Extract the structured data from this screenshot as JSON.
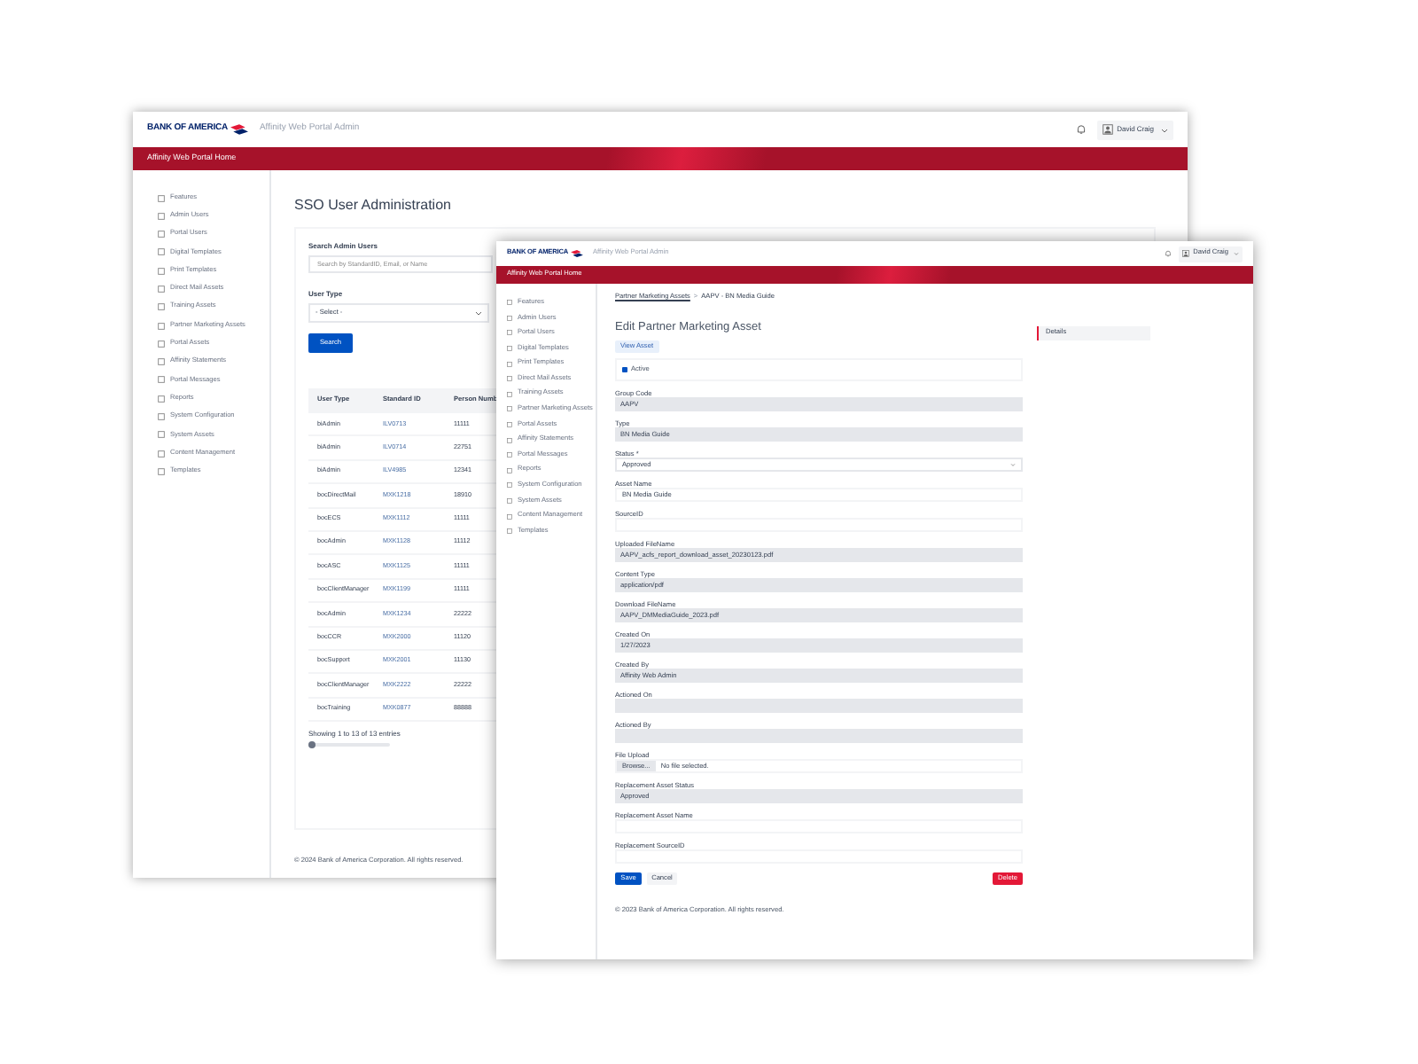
{
  "windows": [
    {
      "kind": "user_admin",
      "brand": "BANK OF AMERICA",
      "app_title": "Affinity Web Portal Admin",
      "user": "David Craig",
      "home_bar": "Affinity Web Portal Home",
      "sidebar": {
        "items": [
          "Features",
          "Admin Users",
          "Portal Users",
          "Digital Templates",
          "Print Templates",
          "Direct Mail Assets",
          "Training Assets",
          "Partner Marketing Assets",
          "Portal Assets",
          "Affinity Statements",
          "Portal Messages",
          "Reports",
          "System Configuration",
          "System Assets",
          "Content Management",
          "Templates"
        ]
      },
      "title": "SSO User Administration",
      "search": {
        "label": "Search Admin Users",
        "placeholder": "Search by StandardID, Email, or Name"
      },
      "user_type": {
        "label": "User Type",
        "value": "- Select -"
      },
      "search_button": "Search",
      "table": {
        "columns": [
          "User Type",
          "Standard ID",
          "Person Numb"
        ],
        "rows": [
          [
            "biAdmin",
            "ILV0713",
            "11111"
          ],
          [
            "biAdmin",
            "ILV0714",
            "22751"
          ],
          [
            "biAdmin",
            "ILV4985",
            "12341"
          ],
          [
            "bocDirectMail",
            "MXK1218",
            "18910"
          ],
          [
            "bocECS",
            "MXK1112",
            "11111"
          ],
          [
            "bocAdmin",
            "MXK1128",
            "11112"
          ],
          [
            "bocASC",
            "MXK1125",
            "11111"
          ],
          [
            "bocClientManager",
            "MXK1199",
            "11111"
          ],
          [
            "bocAdmin",
            "MXK1234",
            "22222"
          ],
          [
            "bocCCR",
            "MXK2000",
            "11120"
          ],
          [
            "bocSupport",
            "MXK2001",
            "11130"
          ],
          [
            "bocClientManager",
            "MXK2222",
            "22222"
          ],
          [
            "bocTraining",
            "MXK0877",
            "88888"
          ]
        ]
      },
      "entries": "Showing 1 to 13 of 13 entries",
      "footer": "© 2024 Bank of America Corporation. All rights reserved."
    },
    {
      "kind": "asset_edit",
      "brand": "BANK OF AMERICA",
      "app_title": "Affinity Web Portal Admin",
      "user": "David Craig",
      "home_bar": "Affinity Web Portal Home",
      "sidebar": {
        "items": [
          "Features",
          "Admin Users",
          "Portal Users",
          "Digital Templates",
          "Print Templates",
          "Direct Mail Assets",
          "Training Assets",
          "Partner Marketing Assets",
          "Portal Assets",
          "Affinity Statements",
          "Portal Messages",
          "Reports",
          "System Configuration",
          "System Assets",
          "Content Management",
          "Templates"
        ]
      },
      "breadcrumb": [
        "Partner Marketing Assets",
        "AAPV - BN Media Guide"
      ],
      "breadcrumb_separator": ">",
      "title": "Edit Partner Marketing Asset",
      "view_button": "View Asset",
      "active": {
        "label": "Active",
        "checked": true
      },
      "fields": [
        {
          "kind": "readonly",
          "label": "Group Code",
          "value": "AAPV"
        },
        {
          "kind": "readonly",
          "label": "Type",
          "value": "BN Media Guide"
        },
        {
          "kind": "select",
          "label": "Status *",
          "value": "Approved"
        },
        {
          "kind": "input",
          "label": "Asset Name",
          "value": "BN Media Guide"
        },
        {
          "kind": "input",
          "label": "SourceID"
        },
        {
          "kind": "readonly",
          "label": "Uploaded FileName",
          "value": "AAPV_acfs_report_download_asset_20230123.pdf"
        },
        {
          "kind": "readonly",
          "label": "Content Type",
          "value": "application/pdf"
        },
        {
          "kind": "readonly",
          "label": "Download FileName",
          "value": "AAPV_DMMediaGuide_2023.pdf"
        },
        {
          "kind": "readonly",
          "label": "Created On",
          "value": "1/27/2023"
        },
        {
          "kind": "readonly",
          "label": "Created By",
          "value": "Affinity Web Admin"
        },
        {
          "kind": "readonly",
          "label": "Actioned On"
        },
        {
          "kind": "readonly",
          "label": "Actioned By"
        },
        {
          "kind": "file",
          "label": "File Upload",
          "button": "Browse...",
          "value": "No file selected."
        },
        {
          "kind": "readonly",
          "label": "Replacement Asset Status",
          "value": "Approved"
        },
        {
          "kind": "input",
          "label": "Replacement Asset Name"
        },
        {
          "kind": "input",
          "label": "Replacement SourceID"
        }
      ],
      "buttons": {
        "save": "Save",
        "cancel": "Cancel",
        "delete": "Delete"
      },
      "side_tabs": [
        {
          "label": "Details",
          "selected": true
        }
      ],
      "footer": "© 2023 Bank of America Corporation. All rights reserved."
    }
  ]
}
